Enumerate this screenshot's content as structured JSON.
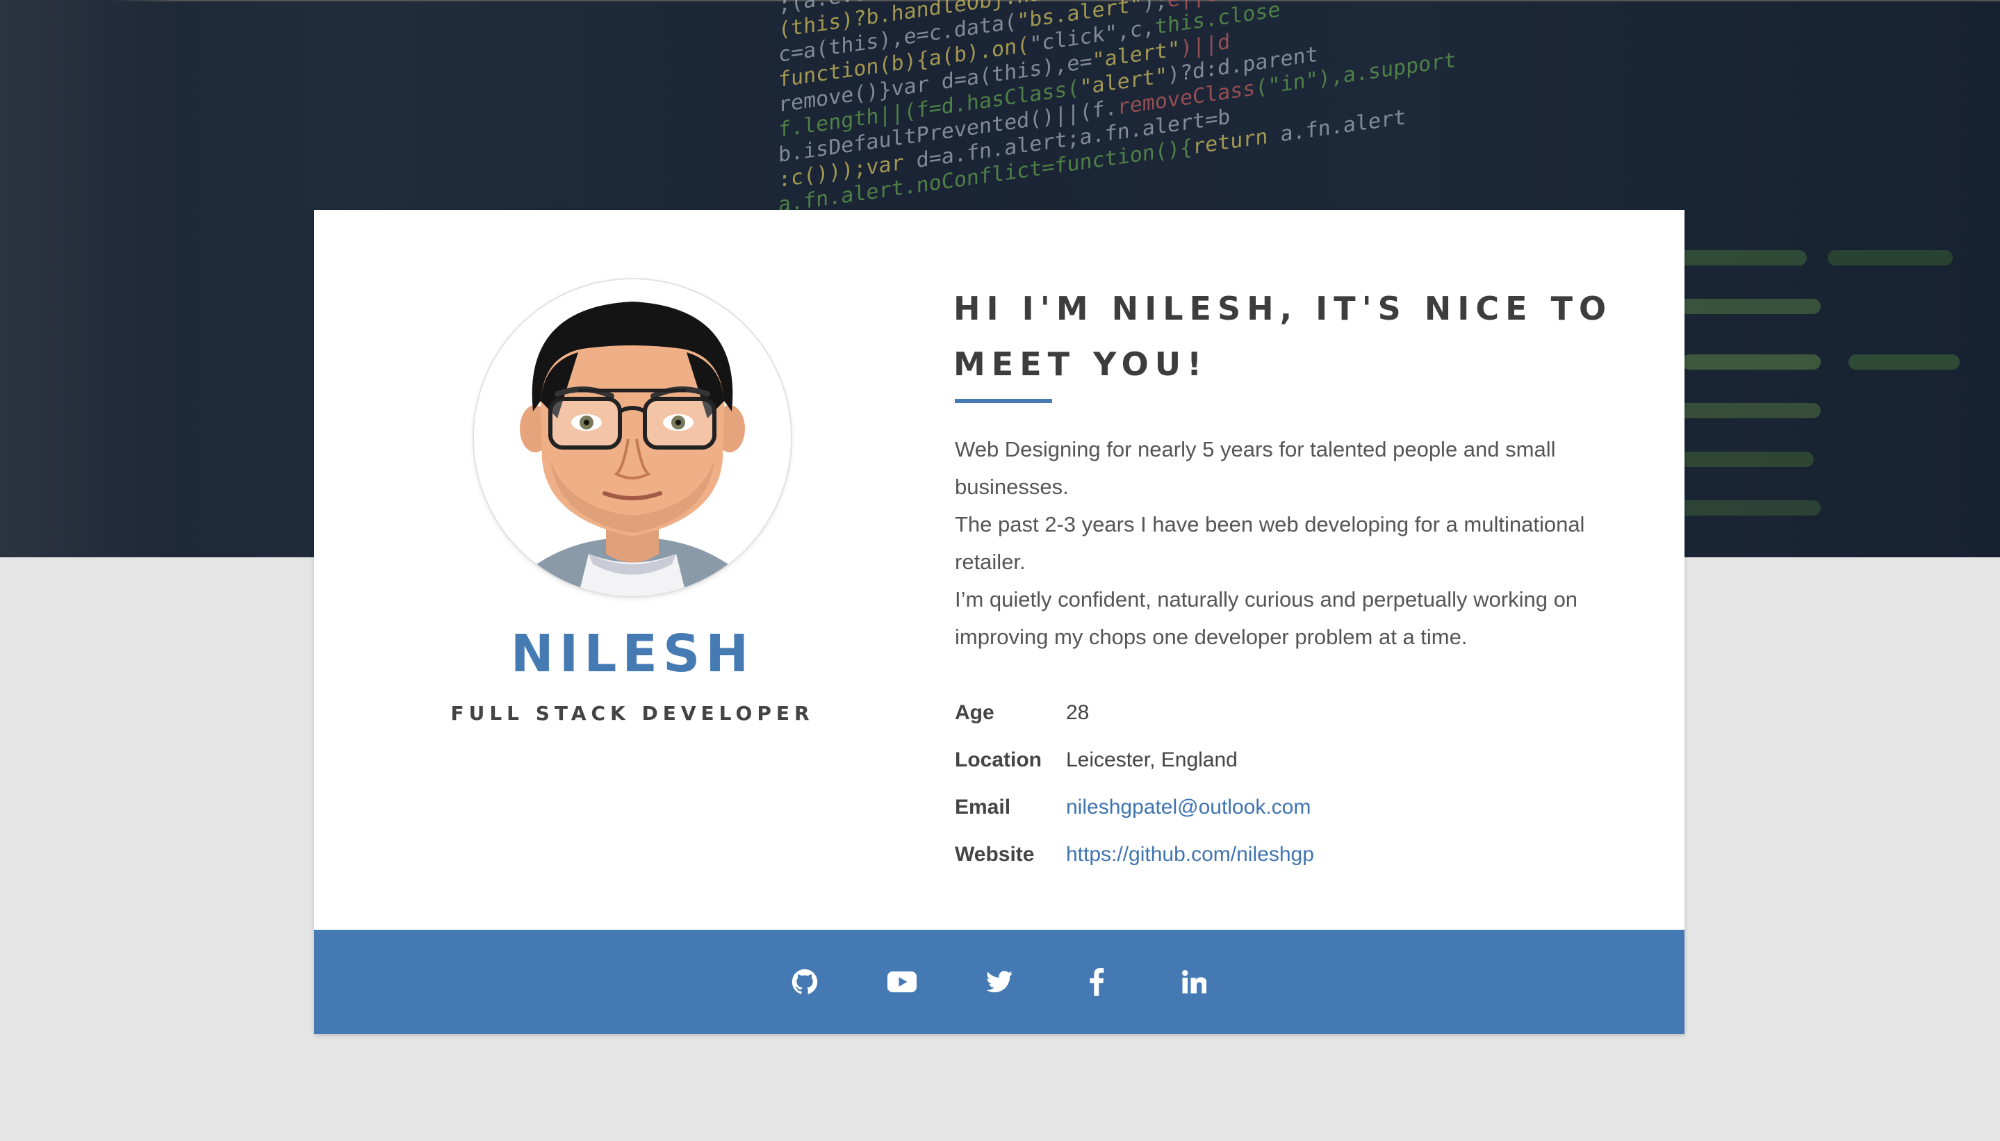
{
  "profile": {
    "name": "NILESH",
    "role": "FULL STACK DEVELOPER",
    "greeting": "HI I'M NILESH, IT'S NICE TO MEET YOU!",
    "bio": [
      "Web Designing for nearly 5 years for talented people and small businesses.",
      "The past 2-3 years I have been web developing for a multinational retailer.",
      "I’m quietly confident, naturally curious and perpetually working on improving my chops one developer problem at a time."
    ]
  },
  "details": {
    "age_label": "Age",
    "age_value": "28",
    "location_label": "Location",
    "location_value": "Leicester, England",
    "email_label": "Email",
    "email_value": "nileshgpatel@outlook.com",
    "website_label": "Website",
    "website_value": "https://github.com/nileshgp"
  },
  "social": [
    {
      "icon": "github-icon"
    },
    {
      "icon": "youtube-icon"
    },
    {
      "icon": "twitter-icon"
    },
    {
      "icon": "facebook-icon"
    },
    {
      "icon": "linkedin-icon"
    }
  ],
  "colors": {
    "accent": "#457ab3",
    "footer": "#4479b3",
    "page_background": "#e5e5e5",
    "hero_background": "#1d2838"
  }
}
